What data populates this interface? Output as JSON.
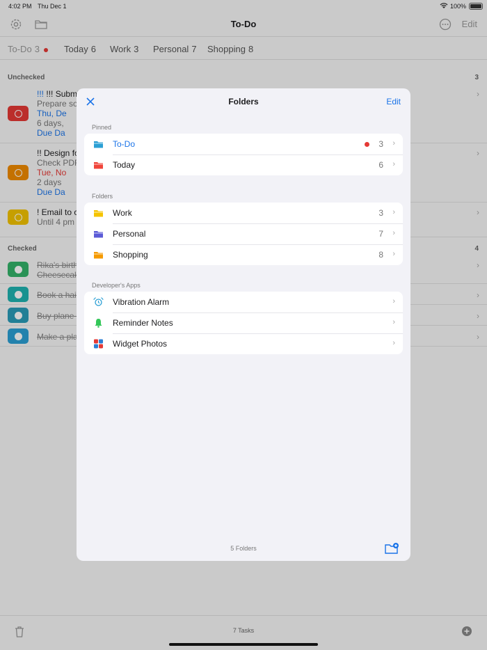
{
  "status": {
    "time": "4:02 PM",
    "date": "Thu Dec 1",
    "battery": "100%"
  },
  "nav": {
    "title": "To-Do",
    "edit": "Edit",
    "settings_icon": "gear-icon",
    "folder_icon": "folder-icon",
    "more_icon": "ellipsis-circle-icon"
  },
  "tabs": [
    {
      "label": "To-Do",
      "count": "3"
    },
    {
      "label": "Today",
      "count": "6"
    },
    {
      "label": "Work",
      "count": "3"
    },
    {
      "label": "Personal",
      "count": "7"
    },
    {
      "label": "Shopping",
      "count": "8"
    }
  ],
  "unchecked": {
    "label": "Unchecked",
    "count": "3"
  },
  "checked": {
    "label": "Checked",
    "count": "4"
  },
  "tasks": [
    {
      "title": "!!! Submit p",
      "l2": "Prepare so",
      "l3": "Thu, De",
      "l4": "6 days,",
      "l5": "Due Da"
    },
    {
      "title": "!! Design fo",
      "l2": "Check PDF",
      "l3": "Tue, No",
      "l4": "2 days",
      "l5": "Due Da"
    },
    {
      "title": "! Email to c",
      "l2": "Until 4 pm"
    }
  ],
  "checked_tasks": [
    {
      "title": "Rika's birth",
      "l2": "Cheesecak"
    },
    {
      "title": "Book a hair"
    },
    {
      "title": "Buy plane t"
    },
    {
      "title": "Make a pla"
    }
  ],
  "colors": {
    "red": "#e53935",
    "orange": "#f08a00",
    "yellow": "#f2c200",
    "green": "#34b36a",
    "teal": "#1fb3b0",
    "cyan": "#2b9fd4",
    "blue": "#1a73e8"
  },
  "bottom": {
    "tasks": "7 Tasks",
    "trash_icon": "trash-icon",
    "add_icon": "plus-circle-icon"
  },
  "modal": {
    "title": "Folders",
    "edit": "Edit",
    "close_icon": "close-icon",
    "pinned_label": "Pinned",
    "pinned": [
      {
        "label": "To-Do",
        "count": "3",
        "icon": "folder-icon"
      },
      {
        "label": "Today",
        "count": "6",
        "icon": "folder-icon"
      }
    ],
    "folders_label": "Folders",
    "folders": [
      {
        "label": "Work",
        "count": "3",
        "icon": "folder-icon"
      },
      {
        "label": "Personal",
        "count": "7",
        "icon": "folder-icon"
      },
      {
        "label": "Shopping",
        "count": "8",
        "icon": "folder-icon"
      }
    ],
    "apps_label": "Developer's Apps",
    "apps": [
      {
        "label": "Vibration Alarm",
        "icon": "alarm-clock-icon"
      },
      {
        "label": "Reminder Notes",
        "icon": "bell-icon"
      },
      {
        "label": "Widget Photos",
        "icon": "widget-grid-icon"
      }
    ],
    "footer": "5 Folders",
    "new_folder_icon": "new-folder-icon"
  }
}
